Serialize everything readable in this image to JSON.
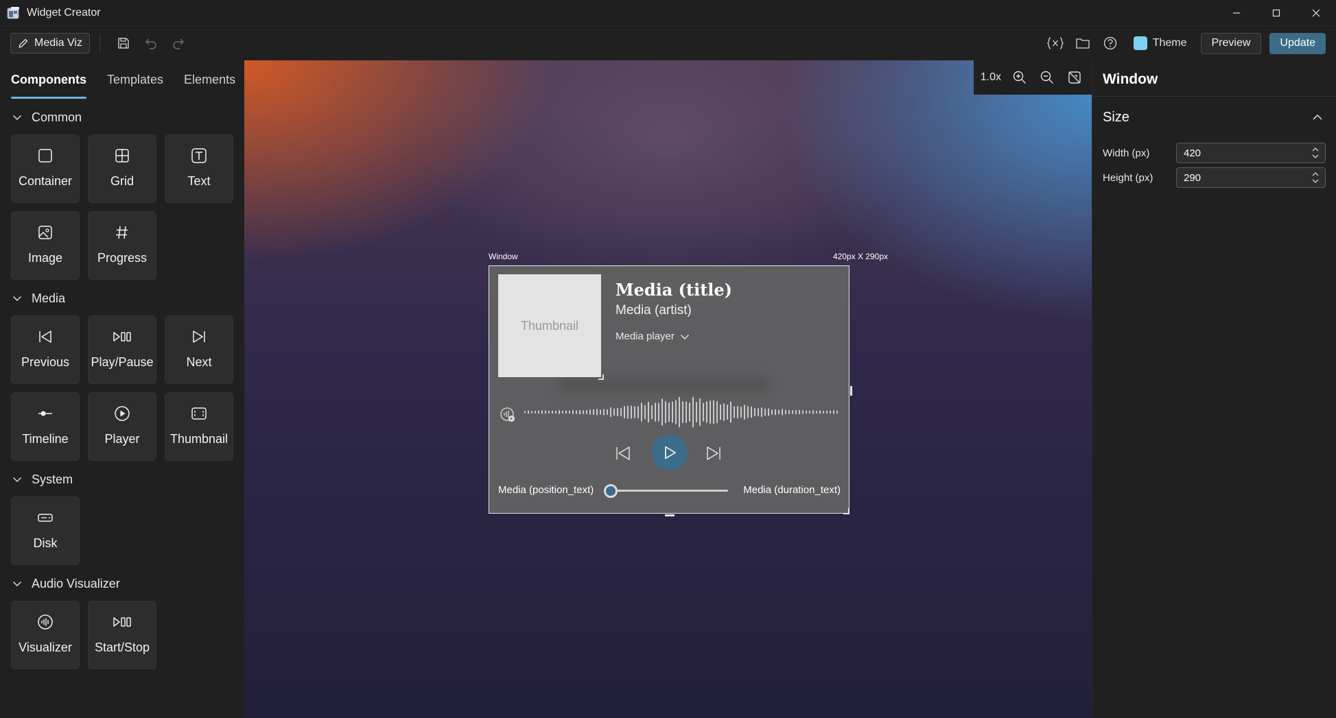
{
  "window": {
    "title": "Widget Creator",
    "app_icon": "widget-app-icon"
  },
  "toolbar": {
    "project_name": "Media Viz",
    "theme_label": "Theme",
    "preview_label": "Preview",
    "update_label": "Update",
    "colors": {
      "theme_swatch": "#7ecff2",
      "update_button": "#3c6b86"
    }
  },
  "left_panel": {
    "tabs": [
      {
        "label": "Components",
        "active": true
      },
      {
        "label": "Templates"
      },
      {
        "label": "Elements"
      }
    ],
    "sections": [
      {
        "title": "Common",
        "items": [
          {
            "label": "Container",
            "icon": "container-icon"
          },
          {
            "label": "Grid",
            "icon": "grid-icon"
          },
          {
            "label": "Text",
            "icon": "text-icon"
          },
          {
            "label": "Image",
            "icon": "image-icon"
          },
          {
            "label": "Progress",
            "icon": "hash-icon"
          }
        ]
      },
      {
        "title": "Media",
        "items": [
          {
            "label": "Previous",
            "icon": "previous-icon"
          },
          {
            "label": "Play/Pause",
            "icon": "play-pause-icon"
          },
          {
            "label": "Next",
            "icon": "next-icon"
          },
          {
            "label": "Timeline",
            "icon": "timeline-icon"
          },
          {
            "label": "Player",
            "icon": "player-icon"
          },
          {
            "label": "Thumbnail",
            "icon": "thumbnail-icon"
          }
        ]
      },
      {
        "title": "System",
        "items": [
          {
            "label": "Disk",
            "icon": "disk-icon"
          }
        ]
      },
      {
        "title": "Audio Visualizer",
        "items": [
          {
            "label": "Visualizer",
            "icon": "visualizer-icon"
          },
          {
            "label": "Start/Stop",
            "icon": "start-stop-icon"
          }
        ]
      }
    ]
  },
  "canvas": {
    "zoom": "1.0x",
    "window_label": "Window",
    "window_size_label": "420px X 290px",
    "widget": {
      "thumbnail_text": "Thumbnail",
      "title": "Media (title)",
      "artist": "Media (artist)",
      "player_select": "Media player",
      "position_text": "Media (position_text)",
      "duration_text": "Media (duration_text)",
      "timeline_progress": 0.0,
      "colors": {
        "play_button": "#3b6c8a",
        "accent": "#6bb7d8"
      }
    }
  },
  "right_panel": {
    "title": "Window",
    "section": "Size",
    "width_label": "Width (px)",
    "width_value": "420",
    "height_label": "Height (px)",
    "height_value": "290"
  }
}
